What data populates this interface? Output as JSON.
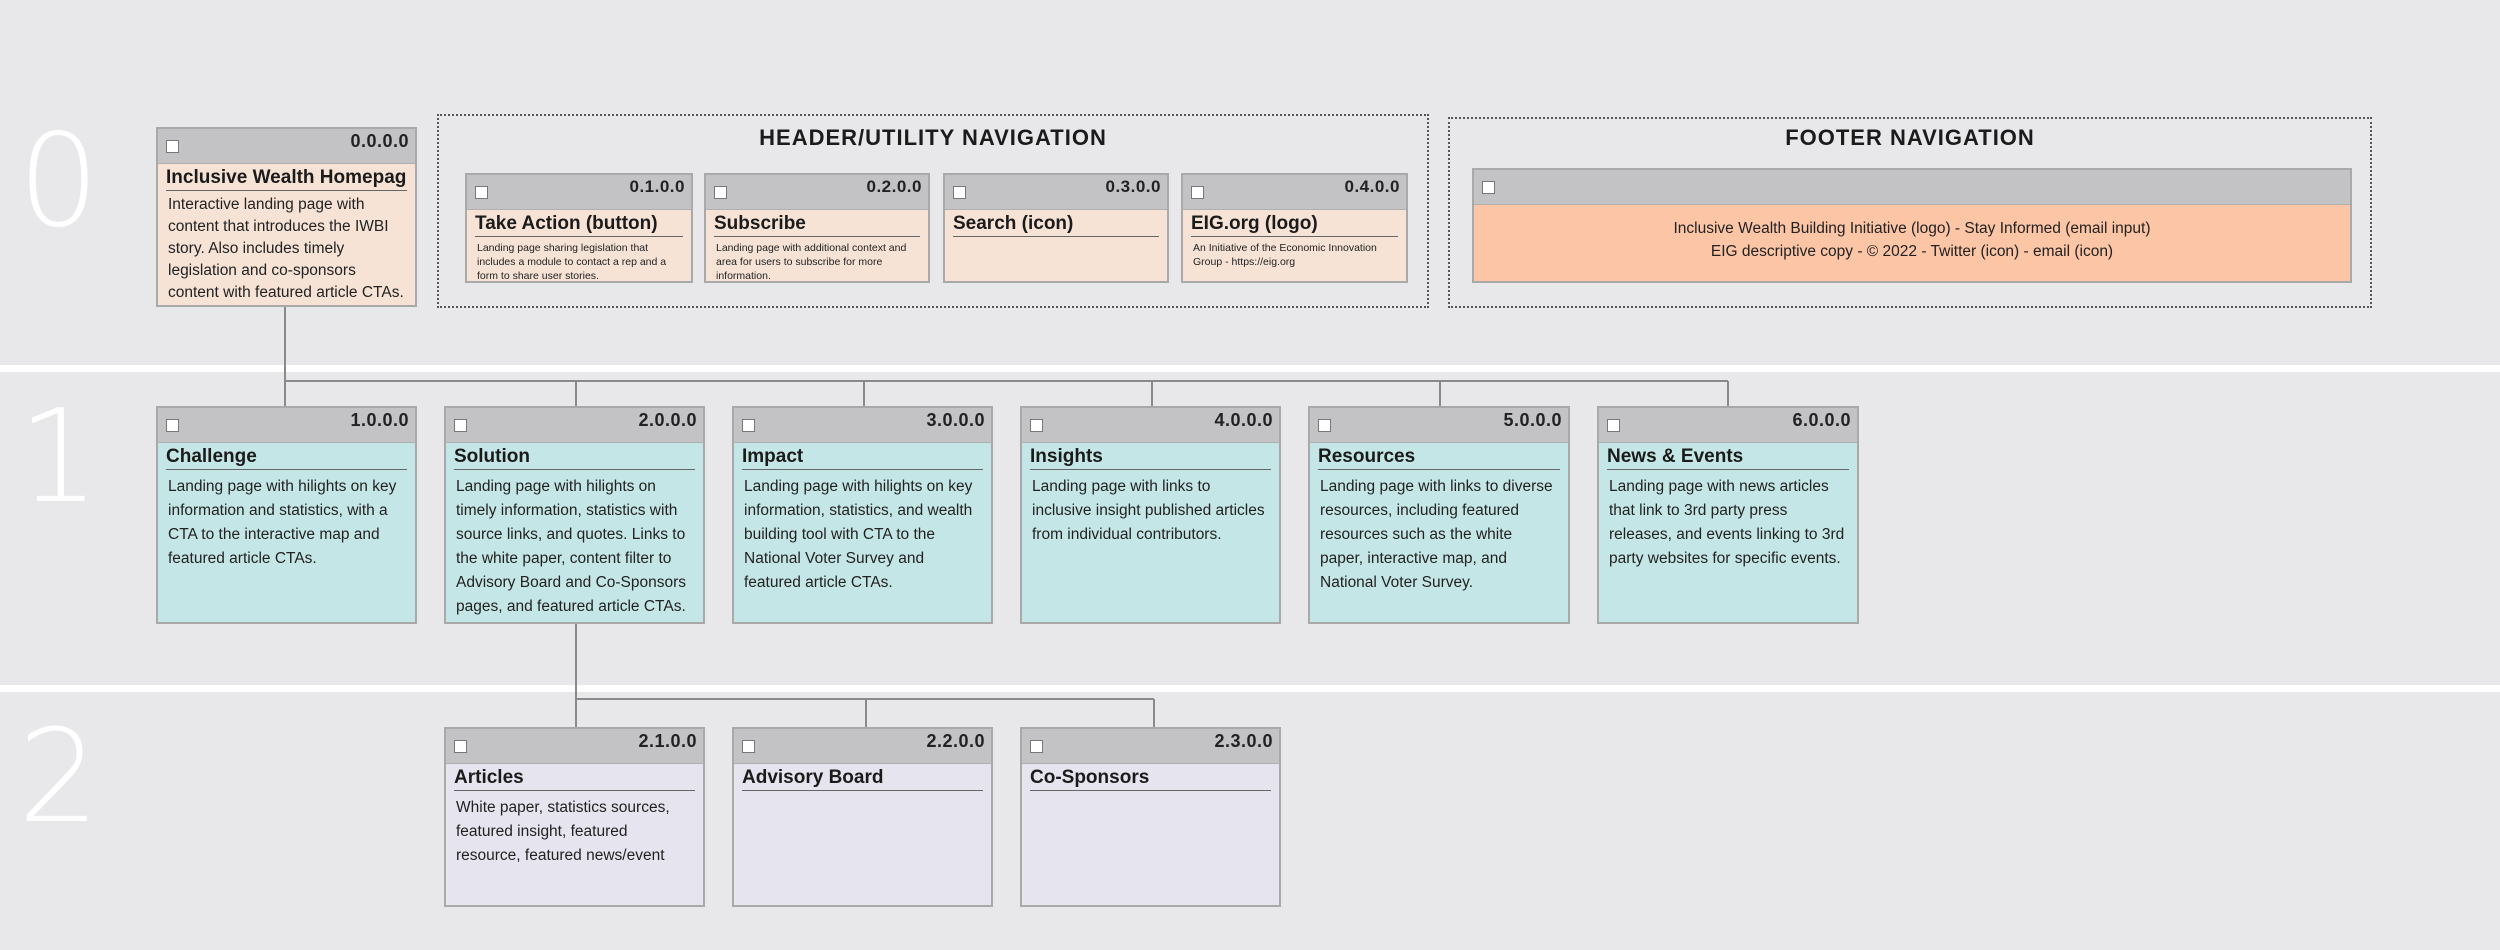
{
  "levels": [
    "0",
    "1",
    "2"
  ],
  "header_nav": {
    "title": "HEADER/UTILITY NAVIGATION"
  },
  "footer_nav": {
    "title": "FOOTER NAVIGATION",
    "line1": "Inclusive Wealth Building Initiative (logo) - Stay Informed (email input)",
    "line2": "EIG descriptive copy - © 2022 - Twitter (icon) - email (icon)"
  },
  "cards": {
    "home": {
      "id": "0.0.0.0",
      "title": "Inclusive Wealth Homepage",
      "desc": "Interactive landing page with content that introduces the IWBI story. Also includes timely legislation and co-sponsors content with featured article CTAs."
    },
    "take_action": {
      "id": "0.1.0.0",
      "title": "Take Action (button)",
      "desc": "Landing page sharing legislation that includes a module to contact a rep and a form to share user stories."
    },
    "subscribe": {
      "id": "0.2.0.0",
      "title": "Subscribe",
      "desc": "Landing page with additional context and area for users to subscribe for more information."
    },
    "search": {
      "id": "0.3.0.0",
      "title": "Search (icon)",
      "desc": ""
    },
    "eig": {
      "id": "0.4.0.0",
      "title": "EIG.org (logo)",
      "desc": "An Initiative of the Economic Innovation Group - https://eig.org"
    },
    "challenge": {
      "id": "1.0.0.0",
      "title": "Challenge",
      "desc": "Landing page with hilights on key information and statistics, with a CTA to the interactive map and featured article CTAs."
    },
    "solution": {
      "id": "2.0.0.0",
      "title": "Solution",
      "desc": "Landing page with hilights on timely information, statistics with source links, and quotes. Links to the white paper, content filter to Advisory Board and Co-Sponsors pages, and featured article CTAs."
    },
    "impact": {
      "id": "3.0.0.0",
      "title": "Impact",
      "desc": "Landing page with hilights on key information, statistics, and wealth building tool with CTA to the National Voter Survey and featured article CTAs."
    },
    "insights": {
      "id": "4.0.0.0",
      "title": "Insights",
      "desc": "Landing page with links to inclusive insight published articles from individual contributors."
    },
    "resources": {
      "id": "5.0.0.0",
      "title": "Resources",
      "desc": "Landing page with links to diverse resources, including featured resources such as the white paper, interactive map, and National Voter Survey."
    },
    "news": {
      "id": "6.0.0.0",
      "title": "News & Events",
      "desc": "Landing page with news articles that link to 3rd party press releases, and events linking to 3rd party websites for specific events."
    },
    "articles": {
      "id": "2.1.0.0",
      "title": "Articles",
      "desc": "White paper, statistics sources, featured insight, featured resource, featured news/event"
    },
    "advisory": {
      "id": "2.2.0.0",
      "title": "Advisory Board",
      "desc": ""
    },
    "cosponsors": {
      "id": "2.3.0.0",
      "title": "Co-Sponsors",
      "desc": ""
    }
  }
}
